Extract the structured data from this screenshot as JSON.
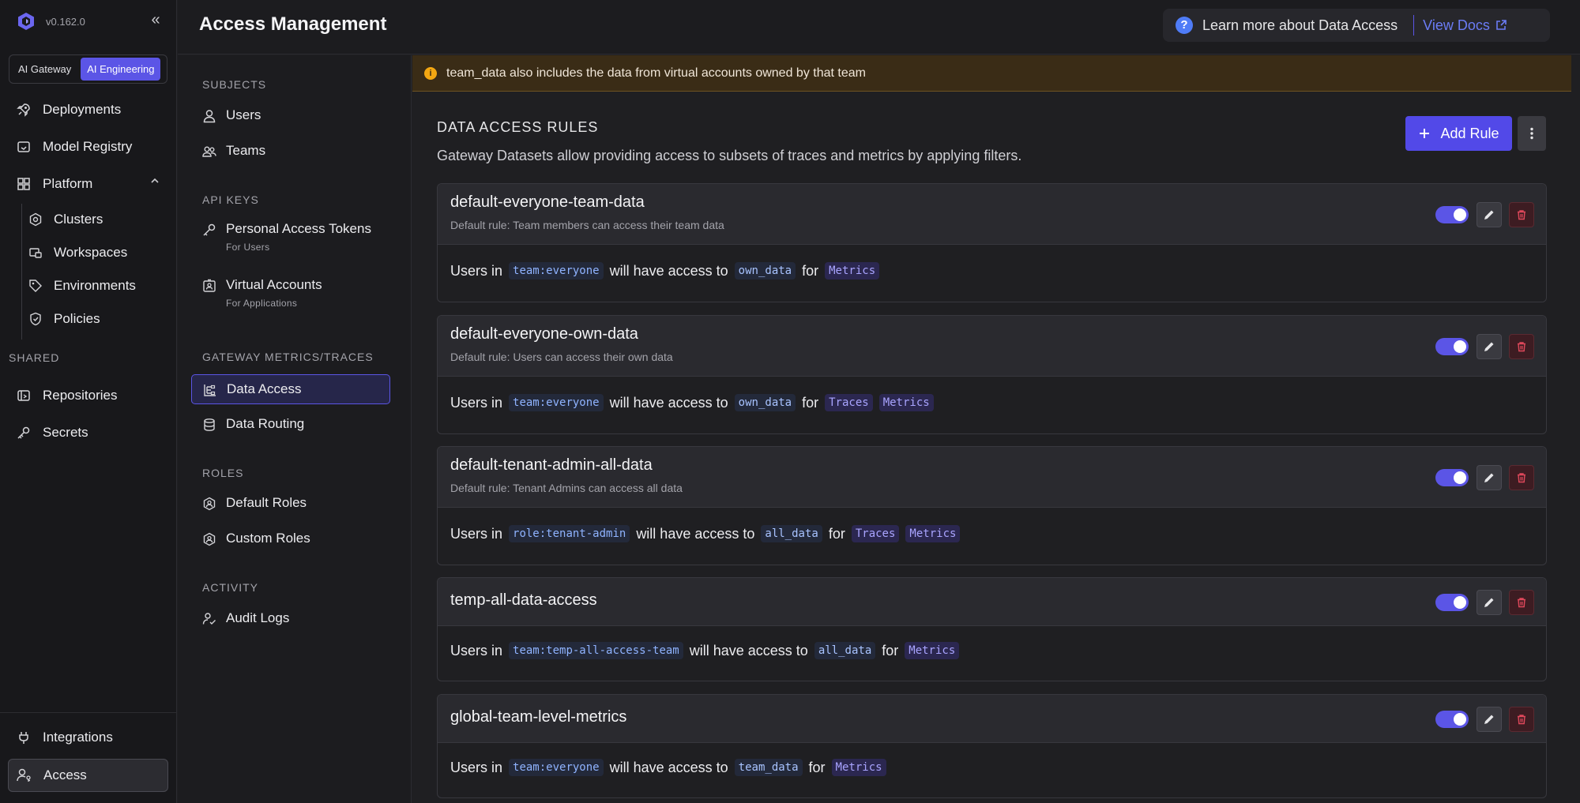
{
  "app": {
    "version": "v0.162.0",
    "switcher": [
      "AI Gateway",
      "AI Engineering"
    ],
    "switcher_active": "AI Engineering"
  },
  "leftnav": {
    "deployments": "Deployments",
    "model_registry": "Model Registry",
    "platform": "Platform",
    "platform_items": [
      "Clusters",
      "Workspaces",
      "Environments",
      "Policies"
    ],
    "shared_label": "SHARED",
    "repositories": "Repositories",
    "secrets": "Secrets",
    "integrations": "Integrations",
    "access": "Access"
  },
  "header": {
    "title": "Access Management",
    "learn_more": "Learn more about Data Access",
    "view_docs": "View Docs"
  },
  "subnav": {
    "subjects_label": "SUBJECTS",
    "users": "Users",
    "teams": "Teams",
    "api_keys_label": "API KEYS",
    "pat": "Personal Access Tokens",
    "pat_hint": "For Users",
    "virtual_accounts": "Virtual Accounts",
    "virtual_accounts_hint": "For Applications",
    "gateway_label": "GATEWAY METRICS/TRACES",
    "data_access": "Data Access",
    "data_routing": "Data Routing",
    "roles_label": "ROLES",
    "default_roles": "Default Roles",
    "custom_roles": "Custom Roles",
    "activity_label": "ACTIVITY",
    "audit_logs": "Audit Logs"
  },
  "banner": {
    "text": "team_data also includes the data from virtual accounts owned by that team"
  },
  "rules_section": {
    "title": "DATA ACCESS RULES",
    "description": "Gateway Datasets allow providing access to subsets of traces and metrics by applying filters.",
    "add_rule": "Add Rule"
  },
  "words": {
    "users_in": "Users in",
    "will_have": "will have access to",
    "for": "for"
  },
  "rules": [
    {
      "name": "default-everyone-team-data",
      "description": "Default rule: Team members can access their team data",
      "subject": "team:everyone",
      "data": "own_data",
      "kinds": [
        "Metrics"
      ],
      "enabled": true
    },
    {
      "name": "default-everyone-own-data",
      "description": "Default rule: Users can access their own data",
      "subject": "team:everyone",
      "data": "own_data",
      "kinds": [
        "Traces",
        "Metrics"
      ],
      "enabled": true
    },
    {
      "name": "default-tenant-admin-all-data",
      "description": "Default rule: Tenant Admins can access all data",
      "subject": "role:tenant-admin",
      "data": "all_data",
      "kinds": [
        "Traces",
        "Metrics"
      ],
      "enabled": true
    },
    {
      "name": "temp-all-data-access",
      "description": "",
      "subject": "team:temp-all-access-team",
      "data": "all_data",
      "kinds": [
        "Metrics"
      ],
      "enabled": true
    },
    {
      "name": "global-team-level-metrics",
      "description": "",
      "subject": "team:everyone",
      "data": "team_data",
      "kinds": [
        "Metrics"
      ],
      "enabled": true
    }
  ]
}
